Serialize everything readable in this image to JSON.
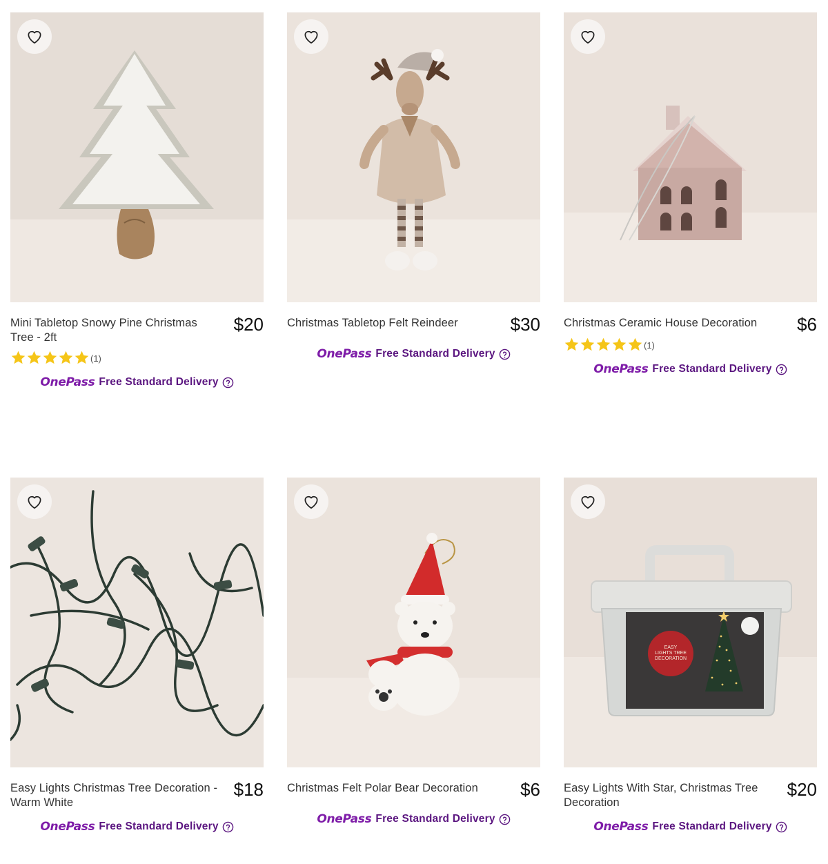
{
  "products": [
    {
      "title": "Mini Tabletop Snowy Pine Christmas Tree - 2ft",
      "price": "$20",
      "rating": 5,
      "rating_count": "(1)",
      "delivery": {
        "brand": "OnePass",
        "text": "Free Standard Delivery"
      }
    },
    {
      "title": "Christmas Tabletop Felt Reindeer",
      "price": "$30",
      "delivery": {
        "brand": "OnePass",
        "text": "Free Standard Delivery"
      }
    },
    {
      "title": "Christmas Ceramic House Decoration",
      "price": "$6",
      "rating": 5,
      "rating_count": "(1)",
      "delivery": {
        "brand": "OnePass",
        "text": "Free Standard Delivery"
      }
    },
    {
      "title": "Easy Lights Christmas Tree Decoration - Warm White",
      "price": "$18",
      "delivery": {
        "brand": "OnePass",
        "text": "Free Standard Delivery"
      }
    },
    {
      "title": "Christmas Felt Polar Bear Decoration",
      "price": "$6",
      "delivery": {
        "brand": "OnePass",
        "text": "Free Standard Delivery"
      }
    },
    {
      "title": "Easy Lights With Star, Christmas Tree Decoration",
      "price": "$20",
      "delivery": {
        "brand": "OnePass",
        "text": "Free Standard Delivery"
      }
    }
  ],
  "product_images": {
    "lights_box_label": [
      "EASY",
      "LIGHTS TREE",
      "DECORATION"
    ]
  },
  "colors": {
    "onepass_purple": "#7e1ca8",
    "delivery_text": "#5b1680",
    "star_gold": "#f5c518",
    "image_bg": "#ebe3dc"
  },
  "icons": {
    "wishlist": "heart-outline-icon",
    "help": "question-circle-icon",
    "rating": "star-icon"
  }
}
